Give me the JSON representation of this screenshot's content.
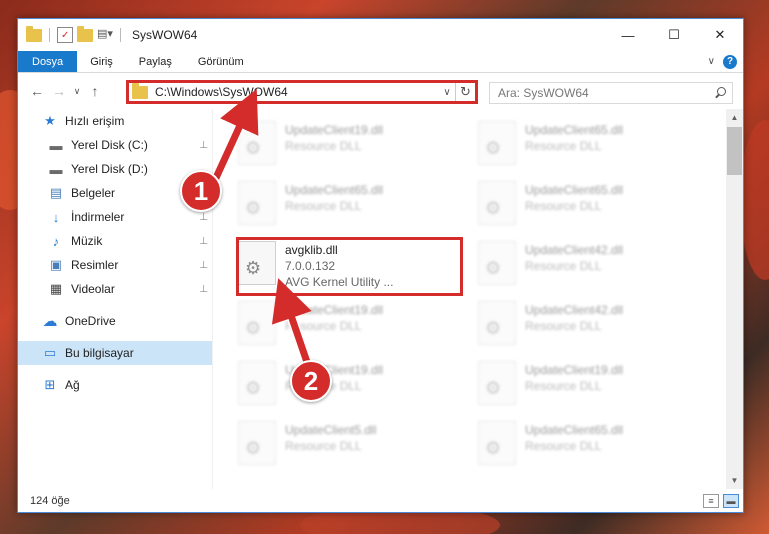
{
  "window": {
    "title": "SysWOW64",
    "minimize_icon": "—",
    "maximize_icon": "☐",
    "close_icon": "✕"
  },
  "ribbon": {
    "tabs": [
      "Dosya",
      "Giriş",
      "Paylaş",
      "Görünüm"
    ],
    "expand_icon": "∨",
    "help_icon": "?"
  },
  "nav": {
    "back": "←",
    "forward": "→",
    "recent": "∨",
    "up": "↑"
  },
  "address": {
    "path": "C:\\Windows\\SysWOW64",
    "dropdown": "∨",
    "refresh": "↻"
  },
  "search": {
    "placeholder": "Ara: SysWOW64"
  },
  "sidebar": {
    "items": [
      {
        "label": "Hızlı erişim",
        "icon": "★"
      },
      {
        "label": "Yerel Disk (C:)",
        "icon": "▬"
      },
      {
        "label": "Yerel Disk (D:)",
        "icon": "▬"
      },
      {
        "label": "Belgeler",
        "icon": "▤"
      },
      {
        "label": "İndirmeler",
        "icon": "↓"
      },
      {
        "label": "Müzik",
        "icon": "♪"
      },
      {
        "label": "Resimler",
        "icon": "▣"
      },
      {
        "label": "Videolar",
        "icon": "▦"
      },
      {
        "label": "OneDrive",
        "icon": "☁"
      },
      {
        "label": "Bu bilgisayar",
        "icon": "▭"
      },
      {
        "label": "Ağ",
        "icon": "⊞"
      }
    ],
    "pin": "📌"
  },
  "files": {
    "left_col": [
      {
        "name": "UpdateClient19.dll",
        "type": "Resource DLL"
      },
      {
        "name": "UpdateClient65.dll",
        "type": "Resource DLL"
      },
      {
        "name": "avgklib.dll",
        "version": "7.0.0.132",
        "desc": "AVG Kernel Utility ..."
      },
      {
        "name": "UpdateClient19.dll",
        "type": "Resource DLL"
      },
      {
        "name": "UpdateClient19.dll",
        "type": "Resource DLL"
      },
      {
        "name": "UpdateClient5.dll",
        "type": "Resource DLL"
      }
    ],
    "right_col": [
      {
        "name": "UpdateClient65.dll",
        "type": "Resource DLL"
      },
      {
        "name": "UpdateClient65.dll",
        "type": "Resource DLL"
      },
      {
        "name": "UpdateClient42.dll",
        "type": "Resource DLL"
      },
      {
        "name": "UpdateClient42.dll",
        "type": "Resource DLL"
      },
      {
        "name": "UpdateClient19.dll",
        "type": "Resource DLL"
      },
      {
        "name": "UpdateClient65.dll",
        "type": "Resource DLL"
      }
    ]
  },
  "status": {
    "count": "124 öğe"
  },
  "annotations": {
    "badge1": "1",
    "badge2": "2"
  },
  "colors": {
    "accent": "#1979ca",
    "annotation_red": "#d42b2b"
  }
}
